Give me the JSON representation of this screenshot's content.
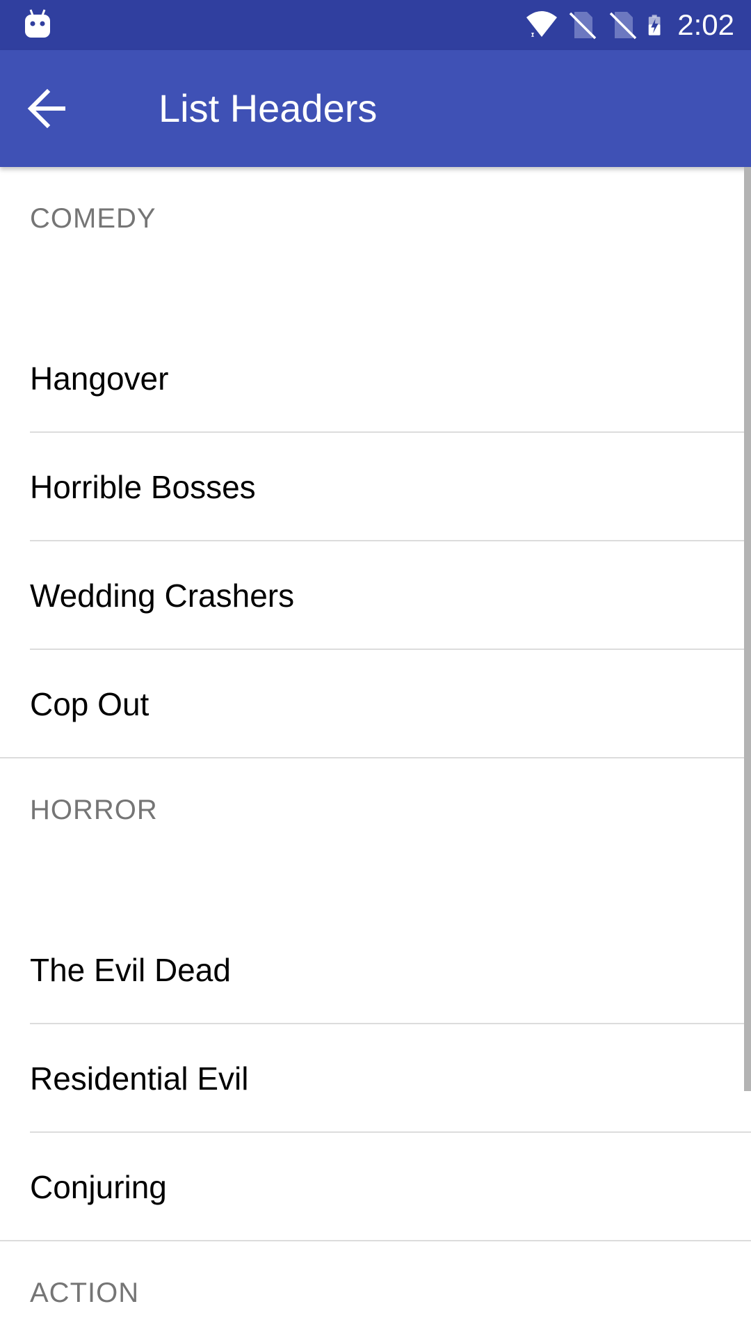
{
  "status_bar": {
    "time": "2:02",
    "icons": [
      "android-debug-icon",
      "wifi-icon",
      "no-sim-icon",
      "no-sim-icon",
      "battery-charging-icon"
    ],
    "background": "#303F9F"
  },
  "toolbar": {
    "title": "List Headers",
    "back_icon": "arrow-back-icon",
    "background": "#3F51B5"
  },
  "sections": [
    {
      "header": "COMEDY",
      "items": [
        "Hangover",
        "Horrible Bosses",
        "Wedding Crashers",
        "Cop Out"
      ]
    },
    {
      "header": "HORROR",
      "items": [
        "The Evil Dead",
        "Residential Evil",
        "Conjuring"
      ]
    },
    {
      "header": "ACTION",
      "items": []
    }
  ]
}
